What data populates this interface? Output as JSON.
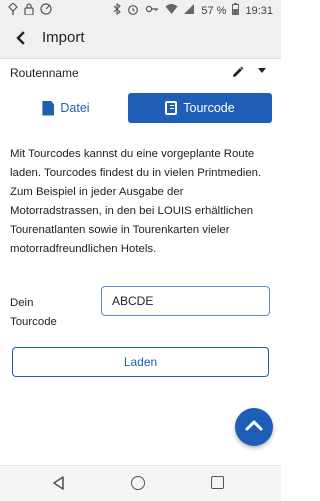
{
  "status_bar": {
    "left_icons": [
      "signal-icon",
      "lock-icon",
      "speedometer-icon"
    ],
    "right_icons": [
      "bluetooth-icon",
      "alarm-icon",
      "key-icon",
      "wifi-icon",
      "cellular-icon"
    ],
    "battery": "57 %",
    "time": "19:31"
  },
  "app_bar": {
    "back_icon": "arrow-left-icon",
    "title": "Import"
  },
  "routenname": {
    "label": "Routenname",
    "edit_icon": "pencil-icon",
    "menu_icon": "dropdown-triangle-icon"
  },
  "tabs": {
    "datei": {
      "label": "Datei",
      "icon": "file-icon"
    },
    "tourcode": {
      "label": "Tourcode",
      "icon": "book-icon"
    }
  },
  "description": "Mit Tourcodes kannst du eine vorgeplante Route laden. Tourcodes findest du in vielen Printmedien. Zum Beispiel in jeder Ausgabe der Motorradstrassen, in den bei LOUIS erhältlichen Tourenatlanten sowie in Tourenkarten vieler motorradfreundlichen Hotels.",
  "tourcode": {
    "label": "Dein Tourcode",
    "value": "ABCDE"
  },
  "load_button": "Laden",
  "fab": {
    "icon": "chevron-up-icon"
  },
  "colors": {
    "accent": "#1f5eb7",
    "appbar": "#f0f0f0",
    "input_border": "#5b8ad0"
  }
}
